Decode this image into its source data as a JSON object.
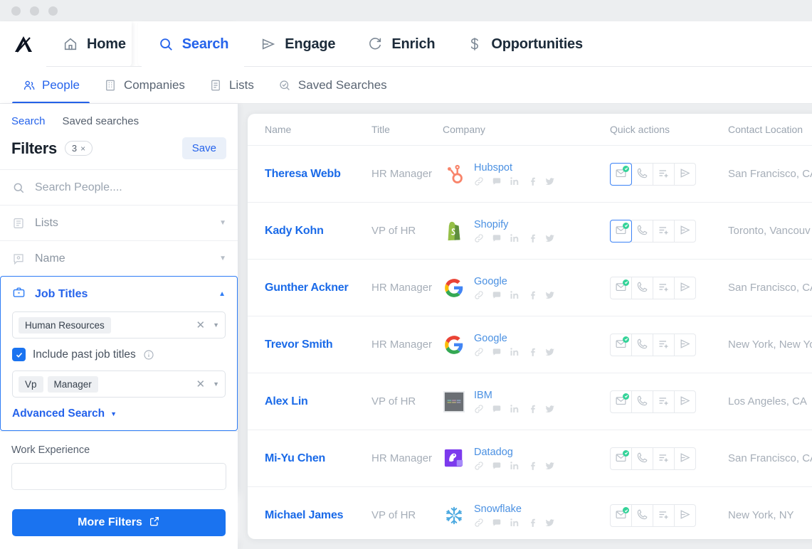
{
  "window": {
    "dots": 3
  },
  "topnav": {
    "logo_name": "apollo-logo",
    "items": [
      {
        "label": "Home",
        "icon": "home-icon",
        "active": false
      },
      {
        "label": "Search",
        "icon": "search-icon",
        "active": true
      },
      {
        "label": "Engage",
        "icon": "send-icon",
        "active": false
      },
      {
        "label": "Enrich",
        "icon": "refresh-icon",
        "active": false
      },
      {
        "label": "Opportunities",
        "icon": "dollar-icon",
        "active": false
      }
    ]
  },
  "subnav": {
    "items": [
      {
        "label": "People",
        "icon": "people-icon",
        "active": true
      },
      {
        "label": "Companies",
        "icon": "building-icon",
        "active": false
      },
      {
        "label": "Lists",
        "icon": "list-icon",
        "active": false
      },
      {
        "label": "Saved Searches",
        "icon": "saved-search-icon",
        "active": false
      }
    ]
  },
  "sidebar": {
    "tabs": [
      {
        "label": "Search",
        "active": true
      },
      {
        "label": "Saved searches",
        "active": false
      }
    ],
    "filters_title": "Filters",
    "filter_count": "3",
    "filter_count_clear": "×",
    "save_label": "Save",
    "search_placeholder": "Search People....",
    "rows": [
      {
        "label": "Lists",
        "icon": "list-icon"
      },
      {
        "label": "Name",
        "icon": "name-badge-icon"
      }
    ],
    "job_titles": {
      "label": "Job Titles",
      "icon": "briefcase-icon",
      "collapse_caret": "▲",
      "primary_chips": [
        "Human Resources"
      ],
      "include_past_label": "Include past job titles",
      "include_past_checked": true,
      "secondary_chips": [
        "Vp",
        "Manager"
      ],
      "advanced_search_label": "Advanced Search"
    },
    "work_experience_label": "Work Experience",
    "more_filters_label": "More Filters"
  },
  "table": {
    "columns": [
      "Name",
      "Title",
      "Company",
      "Quick actions",
      "Contact Location"
    ],
    "quick_actions": [
      {
        "name": "email-action",
        "icon": "envelope-check-icon",
        "badge": true
      },
      {
        "name": "call-action",
        "icon": "phone-icon",
        "badge": false
      },
      {
        "name": "add-to-sequence-action",
        "icon": "list-plus-icon",
        "badge": false
      },
      {
        "name": "send-action",
        "icon": "paper-plane-icon",
        "badge": false
      }
    ],
    "social_icons": [
      "link-icon",
      "chat-icon",
      "linkedin-icon",
      "facebook-icon",
      "twitter-icon"
    ],
    "rows": [
      {
        "name": "Theresa Webb",
        "title": "HR Manager",
        "company": "Hubspot",
        "logo": "hubspot-logo",
        "location": "San Francisco, CA",
        "email_highlighted": true
      },
      {
        "name": "Kady Kohn",
        "title": "VP of HR",
        "company": "Shopify",
        "logo": "shopify-logo",
        "location": "Toronto, Vancouv",
        "email_highlighted": true
      },
      {
        "name": "Gunther Ackner",
        "title": "HR Manager",
        "company": "Google",
        "logo": "google-logo",
        "location": "San Francisco, CA",
        "email_highlighted": false
      },
      {
        "name": "Trevor Smith",
        "title": "HR Manager",
        "company": "Google",
        "logo": "google-logo",
        "location": "New York, New Yo",
        "email_highlighted": false
      },
      {
        "name": "Alex Lin",
        "title": "VP of HR",
        "company": "IBM",
        "logo": "ibm-logo",
        "location": "Los Angeles, CA",
        "email_highlighted": false
      },
      {
        "name": "Mi-Yu Chen",
        "title": "HR Manager",
        "company": "Datadog",
        "logo": "datadog-logo",
        "location": "San Francisco, CA",
        "email_highlighted": false
      },
      {
        "name": "Michael James",
        "title": "VP of HR",
        "company": "Snowflake",
        "logo": "snowflake-logo",
        "location": "New York, NY",
        "email_highlighted": false
      }
    ]
  },
  "colors": {
    "accent_blue": "#2563eb",
    "link_blue": "#1a6ae8",
    "button_blue": "#1a73f0",
    "badge_green": "#34d399",
    "muted_text": "#a6aeb8",
    "page_bg": "#eceef0"
  }
}
